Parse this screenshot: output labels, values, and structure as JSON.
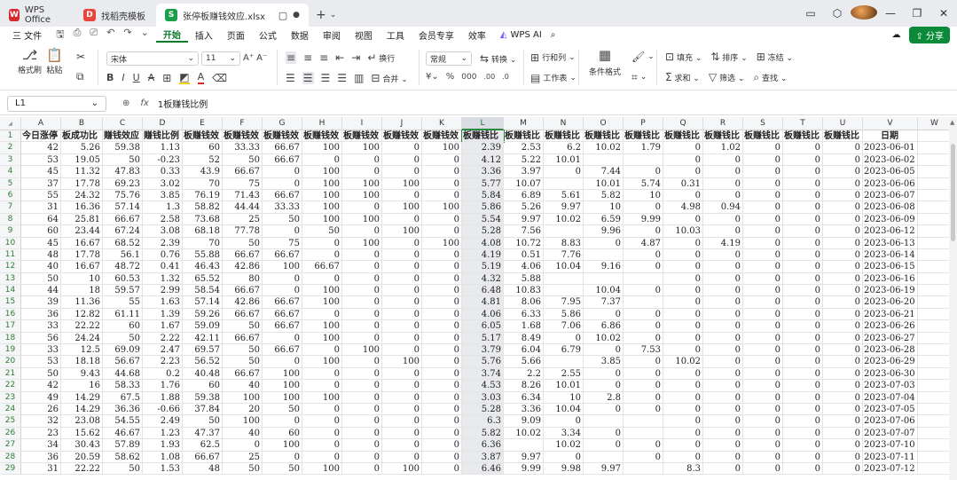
{
  "tabs": {
    "app": "WPS Office",
    "template": "找稻壳模板",
    "file": "张停板赚钱效应.xlsx"
  },
  "menu": {
    "file": "三 文件",
    "items": [
      "开始",
      "插入",
      "页面",
      "公式",
      "数据",
      "审阅",
      "视图",
      "工具",
      "会员专享",
      "效率"
    ],
    "ai": "WPS AI",
    "share": "分享"
  },
  "ribbon": {
    "format_painter": "格式刷",
    "paste": "粘贴",
    "font_name": "宋体",
    "font_size": "11",
    "wrap": "换行",
    "merge": "合并",
    "number_format": "常规",
    "convert": "转换",
    "row_col": "行和列",
    "worksheet": "工作表",
    "cond_format": "条件格式",
    "fill": "填充",
    "sort": "排序",
    "freeze": "冻结",
    "sum": "求和",
    "filter": "筛选",
    "find": "查找"
  },
  "formula_bar": {
    "cell": "L1",
    "content": "1板赚钱比例"
  },
  "colors": {
    "accent": "#0b7a2a",
    "selection": "#2a8a3f"
  },
  "grid": {
    "columns": [
      "A",
      "B",
      "C",
      "D",
      "E",
      "F",
      "G",
      "H",
      "I",
      "J",
      "K",
      "L",
      "M",
      "N",
      "O",
      "P",
      "Q",
      "R",
      "S",
      "T",
      "U",
      "V",
      "W"
    ],
    "header_row": [
      "今日涨停",
      "板成功比",
      "赚钱效应",
      "赚钱比例",
      "板赚钱效",
      "板赚钱效",
      "板赚钱效",
      "板赚钱效",
      "板赚钱效",
      "板赚钱效",
      "板赚钱效",
      "板赚钱比",
      "板赚钱比",
      "板赚钱比",
      "板赚钱比",
      "板赚钱比",
      "板赚钱比",
      "板赚钱比",
      "板赚钱比",
      "板赚钱比",
      "板赚钱比",
      "日期",
      ""
    ],
    "rows": [
      [
        "42",
        "5.26",
        "59.38",
        "1.13",
        "60",
        "33.33",
        "66.67",
        "100",
        "100",
        "0",
        "100",
        "2.39",
        "2.53",
        "6.2",
        "10.02",
        "1.79",
        "0",
        "1.02",
        "0",
        "0",
        "0",
        "2023-06-01",
        ""
      ],
      [
        "53",
        "19.05",
        "50",
        "-0.23",
        "52",
        "50",
        "66.67",
        "0",
        "0",
        "0",
        "0",
        "4.12",
        "5.22",
        "10.01",
        "",
        "",
        "0",
        "0",
        "0",
        "0",
        "0",
        "2023-06-02",
        ""
      ],
      [
        "45",
        "11.32",
        "47.83",
        "0.33",
        "43.9",
        "66.67",
        "0",
        "100",
        "0",
        "0",
        "0",
        "3.36",
        "3.97",
        "0",
        "7.44",
        "0",
        "0",
        "0",
        "0",
        "0",
        "0",
        "2023-06-05",
        ""
      ],
      [
        "37",
        "17.78",
        "69.23",
        "3.02",
        "70",
        "75",
        "0",
        "100",
        "100",
        "100",
        "0",
        "5.77",
        "10.07",
        "",
        "10.01",
        "5.74",
        "0.31",
        "0",
        "0",
        "0",
        "0",
        "2023-06-06",
        ""
      ],
      [
        "55",
        "24.32",
        "75.76",
        "3.85",
        "76.19",
        "71.43",
        "66.67",
        "100",
        "100",
        "0",
        "0",
        "5.84",
        "6.89",
        "5.61",
        "5.82",
        "10",
        "0",
        "0",
        "0",
        "0",
        "0",
        "2023-06-07",
        ""
      ],
      [
        "31",
        "16.36",
        "57.14",
        "1.3",
        "58.82",
        "44.44",
        "33.33",
        "100",
        "0",
        "100",
        "100",
        "5.86",
        "5.26",
        "9.97",
        "10",
        "0",
        "4.98",
        "0.94",
        "0",
        "0",
        "0",
        "2023-06-08",
        ""
      ],
      [
        "64",
        "25.81",
        "66.67",
        "2.58",
        "73.68",
        "25",
        "50",
        "100",
        "100",
        "0",
        "0",
        "5.54",
        "9.97",
        "10.02",
        "6.59",
        "9.99",
        "0",
        "0",
        "0",
        "0",
        "0",
        "2023-06-09",
        ""
      ],
      [
        "60",
        "23.44",
        "67.24",
        "3.08",
        "68.18",
        "77.78",
        "0",
        "50",
        "0",
        "100",
        "0",
        "5.28",
        "7.56",
        "",
        "9.96",
        "0",
        "10.03",
        "0",
        "0",
        "0",
        "0",
        "2023-06-12",
        ""
      ],
      [
        "45",
        "16.67",
        "68.52",
        "2.39",
        "70",
        "50",
        "75",
        "0",
        "100",
        "0",
        "100",
        "4.08",
        "10.72",
        "8.83",
        "0",
        "4.87",
        "0",
        "4.19",
        "0",
        "0",
        "0",
        "2023-06-13",
        ""
      ],
      [
        "48",
        "17.78",
        "56.1",
        "0.76",
        "55.88",
        "66.67",
        "66.67",
        "0",
        "0",
        "0",
        "0",
        "4.19",
        "0.51",
        "7.76",
        "",
        "0",
        "0",
        "0",
        "0",
        "0",
        "0",
        "2023-06-14",
        ""
      ],
      [
        "40",
        "16.67",
        "48.72",
        "0.41",
        "46.43",
        "42.86",
        "100",
        "66.67",
        "0",
        "0",
        "0",
        "5.19",
        "4.06",
        "10.04",
        "9.16",
        "0",
        "0",
        "0",
        "0",
        "0",
        "0",
        "2023-06-15",
        ""
      ],
      [
        "50",
        "10",
        "60.53",
        "1.32",
        "65.52",
        "80",
        "0",
        "0",
        "0",
        "0",
        "0",
        "4.32",
        "5.88",
        "",
        "",
        "",
        "0",
        "0",
        "0",
        "0",
        "0",
        "2023-06-16",
        ""
      ],
      [
        "44",
        "18",
        "59.57",
        "2.99",
        "58.54",
        "66.67",
        "0",
        "100",
        "0",
        "0",
        "0",
        "6.48",
        "10.83",
        "",
        "10.04",
        "0",
        "0",
        "0",
        "0",
        "0",
        "0",
        "2023-06-19",
        ""
      ],
      [
        "39",
        "11.36",
        "55",
        "1.63",
        "57.14",
        "42.86",
        "66.67",
        "100",
        "0",
        "0",
        "0",
        "4.81",
        "8.06",
        "7.95",
        "7.37",
        "",
        "0",
        "0",
        "0",
        "0",
        "0",
        "2023-06-20",
        ""
      ],
      [
        "36",
        "12.82",
        "61.11",
        "1.39",
        "59.26",
        "66.67",
        "66.67",
        "0",
        "0",
        "0",
        "0",
        "4.06",
        "6.33",
        "5.86",
        "0",
        "0",
        "0",
        "0",
        "0",
        "0",
        "0",
        "2023-06-21",
        ""
      ],
      [
        "33",
        "22.22",
        "60",
        "1.67",
        "59.09",
        "50",
        "66.67",
        "100",
        "0",
        "0",
        "0",
        "6.05",
        "1.68",
        "7.06",
        "6.86",
        "0",
        "0",
        "0",
        "0",
        "0",
        "0",
        "2023-06-26",
        ""
      ],
      [
        "56",
        "24.24",
        "50",
        "2.22",
        "42.11",
        "66.67",
        "0",
        "100",
        "0",
        "0",
        "0",
        "5.17",
        "8.49",
        "0",
        "10.02",
        "0",
        "0",
        "0",
        "0",
        "0",
        "0",
        "2023-06-27",
        ""
      ],
      [
        "33",
        "12.5",
        "69.09",
        "2.47",
        "69.57",
        "50",
        "66.67",
        "0",
        "100",
        "0",
        "0",
        "3.79",
        "6.04",
        "6.79",
        "0",
        "7.53",
        "0",
        "0",
        "0",
        "0",
        "0",
        "2023-06-28",
        ""
      ],
      [
        "53",
        "18.18",
        "56.67",
        "2.23",
        "56.52",
        "50",
        "0",
        "100",
        "0",
        "100",
        "0",
        "5.76",
        "5.66",
        "",
        "3.85",
        "0",
        "10.02",
        "0",
        "0",
        "0",
        "0",
        "2023-06-29",
        ""
      ],
      [
        "50",
        "9.43",
        "44.68",
        "0.2",
        "40.48",
        "66.67",
        "100",
        "0",
        "0",
        "0",
        "0",
        "3.74",
        "2.2",
        "2.55",
        "0",
        "0",
        "0",
        "0",
        "0",
        "0",
        "0",
        "2023-06-30",
        ""
      ],
      [
        "42",
        "16",
        "58.33",
        "1.76",
        "60",
        "40",
        "100",
        "0",
        "0",
        "0",
        "0",
        "4.53",
        "8.26",
        "10.01",
        "0",
        "0",
        "0",
        "0",
        "0",
        "0",
        "0",
        "2023-07-03",
        ""
      ],
      [
        "49",
        "14.29",
        "67.5",
        "1.88",
        "59.38",
        "100",
        "100",
        "100",
        "0",
        "0",
        "0",
        "3.03",
        "6.34",
        "10",
        "2.8",
        "0",
        "0",
        "0",
        "0",
        "0",
        "0",
        "2023-07-04",
        ""
      ],
      [
        "26",
        "14.29",
        "36.36",
        "-0.66",
        "37.84",
        "20",
        "50",
        "0",
        "0",
        "0",
        "0",
        "5.28",
        "3.36",
        "10.04",
        "0",
        "0",
        "0",
        "0",
        "0",
        "0",
        "0",
        "2023-07-05",
        ""
      ],
      [
        "32",
        "23.08",
        "54.55",
        "2.49",
        "50",
        "100",
        "0",
        "0",
        "0",
        "0",
        "0",
        "6.3",
        "9.09",
        "0",
        "",
        "",
        "0",
        "0",
        "0",
        "0",
        "0",
        "2023-07-06",
        ""
      ],
      [
        "23",
        "15.62",
        "46.67",
        "1.23",
        "47.37",
        "40",
        "60",
        "0",
        "0",
        "0",
        "0",
        "5.82",
        "10.02",
        "3.34",
        "0",
        "",
        "0",
        "0",
        "0",
        "0",
        "0",
        "2023-07-07",
        ""
      ],
      [
        "34",
        "30.43",
        "57.89",
        "1.93",
        "62.5",
        "0",
        "100",
        "0",
        "0",
        "0",
        "0",
        "6.36",
        "",
        "10.02",
        "0",
        "0",
        "0",
        "0",
        "0",
        "0",
        "0",
        "2023-07-10",
        ""
      ],
      [
        "36",
        "20.59",
        "58.62",
        "1.08",
        "66.67",
        "25",
        "0",
        "0",
        "0",
        "0",
        "0",
        "3.87",
        "9.97",
        "0",
        "",
        "0",
        "0",
        "0",
        "0",
        "0",
        "0",
        "2023-07-11",
        ""
      ],
      [
        "31",
        "22.22",
        "50",
        "1.53",
        "48",
        "50",
        "50",
        "100",
        "0",
        "100",
        "0",
        "6.46",
        "9.99",
        "9.98",
        "9.97",
        "",
        "8.3",
        "0",
        "0",
        "0",
        "0",
        "2023-07-12",
        ""
      ]
    ]
  }
}
